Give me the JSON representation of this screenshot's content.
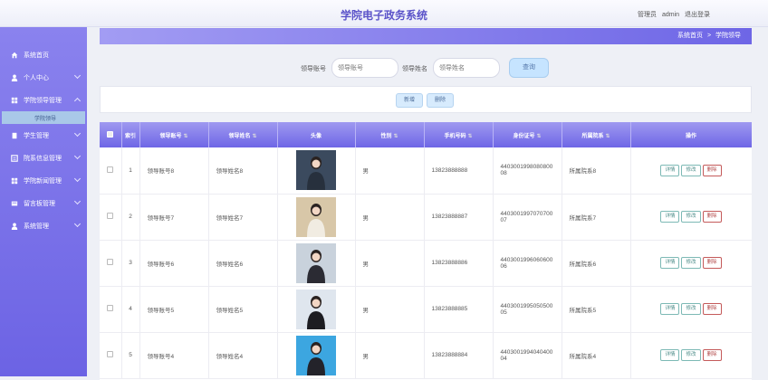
{
  "header": {
    "title": "学院电子政务系统",
    "role": "管理员",
    "username": "admin",
    "logout": "退出登录"
  },
  "sidebar": {
    "items": [
      {
        "label": "系统首页",
        "icon": "home-icon"
      },
      {
        "label": "个人中心",
        "icon": "user-icon"
      },
      {
        "label": "学院领导管理",
        "icon": "grid-icon",
        "expanded": true
      },
      {
        "label": "学生管理",
        "icon": "file-icon"
      },
      {
        "label": "院系信息管理",
        "icon": "list-icon"
      },
      {
        "label": "学院新闻管理",
        "icon": "grid-icon"
      },
      {
        "label": "留言板管理",
        "icon": "card-icon"
      },
      {
        "label": "系统管理",
        "icon": "user-icon"
      }
    ],
    "submenu": {
      "label": "学院领导"
    }
  },
  "breadcrumb": {
    "home": "系统首页",
    "sep": ">",
    "current": "学院领导"
  },
  "search": {
    "account_label": "领导账号",
    "account_placeholder": "领导账号",
    "name_label": "领导姓名",
    "name_placeholder": "领导姓名",
    "button": "查询"
  },
  "actions": {
    "add": "新增",
    "delete": "删除"
  },
  "table": {
    "headers": [
      "索引",
      "领导账号",
      "领导姓名",
      "头像",
      "性别",
      "手机号码",
      "身份证号",
      "所属院系",
      "操作"
    ],
    "ops": {
      "detail": "详情",
      "edit": "修改",
      "delete": "删除"
    },
    "rows": [
      {
        "index": "1",
        "account": "领导账号8",
        "name": "领导姓名8",
        "gender": "男",
        "phone": "13823888888",
        "idcard": "440300199808080008",
        "dept": "所属院系8"
      },
      {
        "index": "2",
        "account": "领导账号7",
        "name": "领导姓名7",
        "gender": "男",
        "phone": "13823888887",
        "idcard": "440300199707070007",
        "dept": "所属院系7"
      },
      {
        "index": "3",
        "account": "领导账号6",
        "name": "领导姓名6",
        "gender": "男",
        "phone": "13823888886",
        "idcard": "440300199606060006",
        "dept": "所属院系6"
      },
      {
        "index": "4",
        "account": "领导账号5",
        "name": "领导姓名5",
        "gender": "男",
        "phone": "13823888885",
        "idcard": "440300199505050005",
        "dept": "所属院系5"
      },
      {
        "index": "5",
        "account": "领导账号4",
        "name": "领导姓名4",
        "gender": "男",
        "phone": "13823888884",
        "idcard": "440300199404040004",
        "dept": "所属院系4"
      }
    ]
  },
  "colors": {
    "accent": "#6c63e4",
    "accent_light": "#a29cf3",
    "title": "#5b53c9"
  }
}
